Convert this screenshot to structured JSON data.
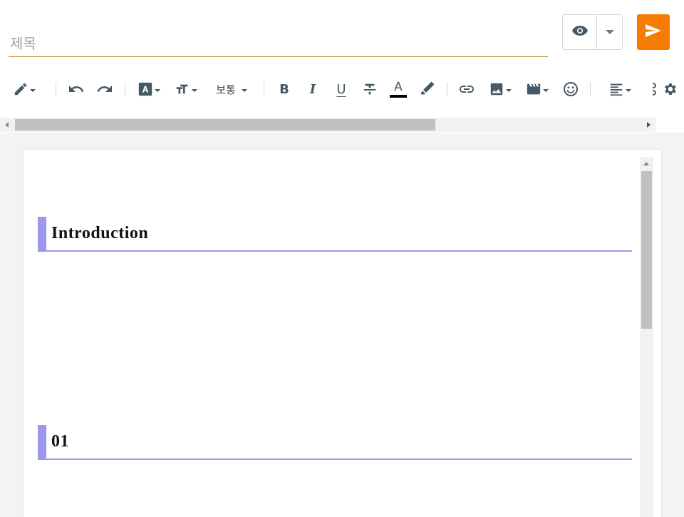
{
  "title": {
    "placeholder": "제목",
    "value": ""
  },
  "header": {
    "preview_icon": "eye-icon",
    "preview_dropdown_icon": "caret-down-icon",
    "publish_icon": "send-icon",
    "publish_color": "#f57c00"
  },
  "toolbar": {
    "items": [
      {
        "name": "pencil-mode",
        "icon": "pencil-icon",
        "dropdown": true
      },
      {
        "name": "undo",
        "icon": "undo-icon"
      },
      {
        "name": "redo",
        "icon": "redo-icon"
      },
      {
        "name": "text-style",
        "icon": "text-box-icon",
        "dropdown": true
      },
      {
        "name": "font-size",
        "icon": "font-size-icon",
        "dropdown": true
      },
      {
        "name": "paragraph-style",
        "label": "보통",
        "dropdown": true
      },
      {
        "name": "bold",
        "label": "B"
      },
      {
        "name": "italic",
        "label": "I"
      },
      {
        "name": "underline",
        "label": "U"
      },
      {
        "name": "strikethrough",
        "icon": "strikethrough-icon"
      },
      {
        "name": "text-color",
        "label": "A",
        "color": "#000000"
      },
      {
        "name": "highlight",
        "icon": "marker-icon"
      },
      {
        "name": "link",
        "icon": "link-icon"
      },
      {
        "name": "image",
        "icon": "image-icon",
        "dropdown": true
      },
      {
        "name": "video",
        "icon": "video-icon",
        "dropdown": true
      },
      {
        "name": "emoji",
        "icon": "smiley-icon"
      },
      {
        "name": "align",
        "icon": "align-left-icon",
        "dropdown": true
      },
      {
        "name": "more",
        "icon": "more-icon"
      },
      {
        "name": "settings",
        "icon": "gear-icon"
      }
    ],
    "paragraph_style": "보통",
    "bold_label": "B",
    "italic_label": "I",
    "underline_label": "U",
    "text_color_label": "A"
  },
  "document": {
    "headings": [
      {
        "text": "Introduction",
        "accent": "#9c98ee"
      },
      {
        "text": "01",
        "accent": "#9c98ee"
      }
    ]
  }
}
